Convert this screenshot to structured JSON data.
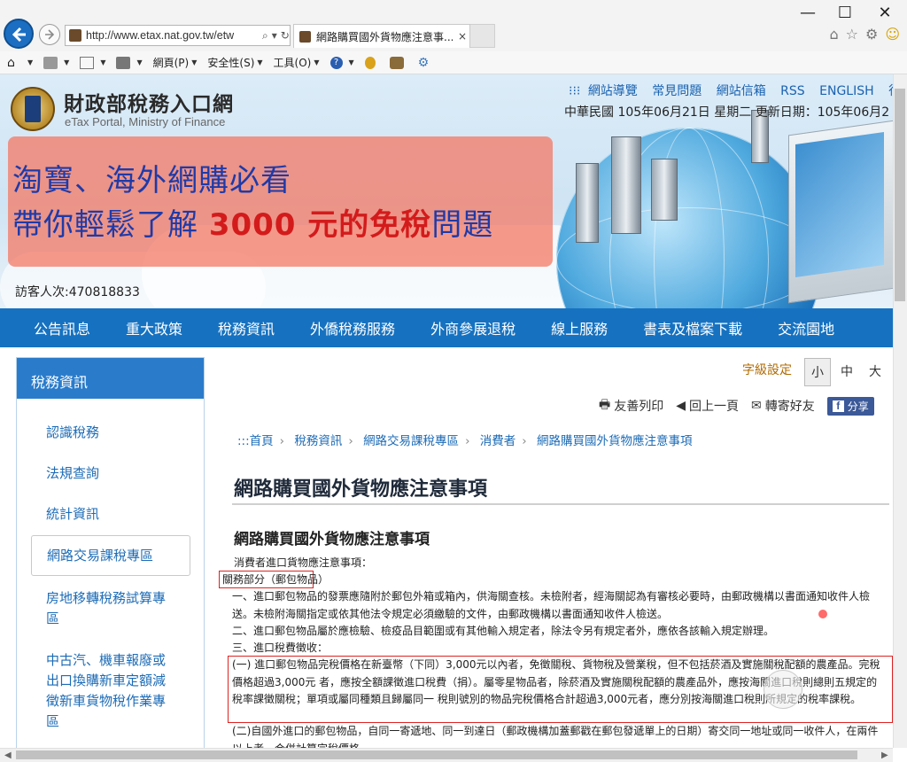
{
  "browser": {
    "url": "http://www.etax.nat.gov.tw/etw",
    "tab_title": "網路購買國外貨物應注意事...",
    "tab_close": "×",
    "minimize": "—",
    "maximize": "☐",
    "close": "✕",
    "toolbar": {
      "page_menu": "網頁(P)",
      "safety_menu": "安全性(S)",
      "tools_menu": "工具(O)"
    }
  },
  "site": {
    "logo_title": "財政部稅務入口網",
    "logo_subtitle": "eTax Portal, Ministry of Finance",
    "top_links": [
      "網站導覽",
      "常見問題",
      "網站信箱",
      "RSS",
      "ENGLISH",
      "行動"
    ],
    "date_line": "中華民國 105年06月21日 星期二 更新日期：105年06月2",
    "promo_line1": "淘寶、海外網購必看",
    "promo_line2_a": "帶你輕鬆了解 ",
    "promo_line2_b": "3000 元的免稅",
    "promo_line2_c": "問題",
    "visitor": "訪客人次:470818833",
    "nav": [
      "公告訊息",
      "重大政策",
      "稅務資訊",
      "外僑稅務服務",
      "外商參展退稅",
      "線上服務",
      "書表及檔案下載",
      "交流園地"
    ]
  },
  "sidebar": {
    "title": "稅務資訊",
    "items": [
      "認識稅務",
      "法規查詢",
      "統計資訊",
      "網路交易課稅專區",
      "房地移轉稅務試算專區",
      "中古汽、機車報廢或出口換購新車定額減徵新車貨物稅作業專區"
    ]
  },
  "content": {
    "font_setting_label": "字級設定",
    "font_sizes": [
      "小",
      "中",
      "大"
    ],
    "actions": {
      "print": "友善列印",
      "back": "回上一頁",
      "mail": "轉寄好友",
      "share": "分享"
    },
    "breadcrumb": [
      ":::首頁",
      "稅務資訊",
      "網路交易課稅專區",
      "消費者",
      "網路購買國外貨物應注意事項"
    ],
    "page_title": "網路購買國外貨物應注意事項",
    "sub_title": "網路購買國外貨物應注意事項",
    "p0": "消費者進口貨物應注意事項：",
    "p1": "關務部分（郵包物品）",
    "p2": "一、進口郵包物品的發票應隨附於郵包外箱或箱內，供海關查核。未檢附者，經海關認為有審核必要時，由郵政機構以書面通知收件人檢送。未檢附海關指定或依其他法令規定必須繳驗的文件，由郵政機構以書面通知收件人檢送。",
    "p3": "二、進口郵包物品屬於應檢驗、檢疫品目範圍或有其他輸入規定者，除法令另有規定者外，應依各該輸入規定辦理。",
    "p4": "三、進口稅費徵收：",
    "p5": "(一) 進口郵包物品完稅價格在新臺幣（下同）3,000元以內者，免徵關稅、貨物稅及營業稅，但不包括菸酒及實施關稅配額的農產品。完稅價格超過3,000元 者，應按全額課徵進口稅費（捐）。屬零星物品者，除菸酒及實施關稅配額的農產品外，應按海關進口稅則總則五規定的稅率課徵關稅；單項或屬同種類且歸屬同一 稅則號別的物品完稅價格合計超過3,000元者，應分別按海關進口稅則所規定的稅率課稅。",
    "p6": "(二)自國外進口的郵包物品，自同一寄遞地、同一到達日（郵政機構加蓋郵戳在郵包發遞單上的日期）寄交同一地址或同一收件人，在兩件以上者，合併計算完稅價格。"
  }
}
